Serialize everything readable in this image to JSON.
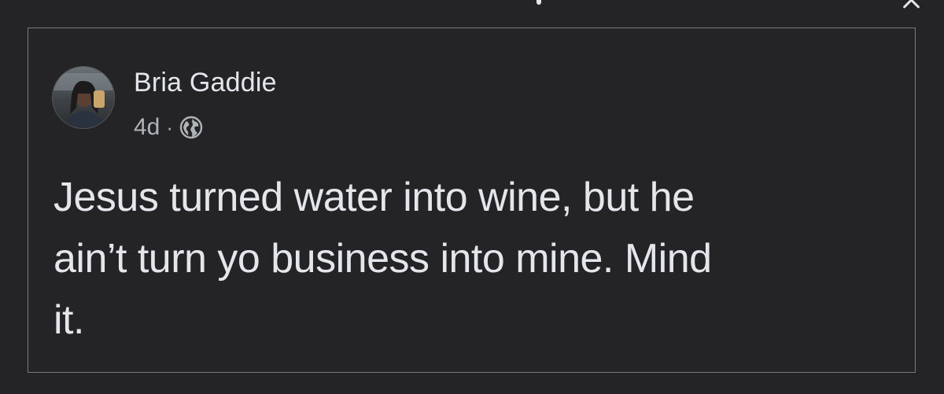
{
  "post": {
    "author_name": "Bria Gaddie",
    "timestamp": "4d",
    "separator": "·",
    "audience_icon": "globe-icon",
    "text": "Jesus turned water into wine, but he\nain’t turn yo business into mine. Mind\nit."
  },
  "colors": {
    "background": "#242426",
    "primary_text": "#e4e6eb",
    "secondary_text": "#b0b3b8",
    "border": "#7a7a7c"
  },
  "icons": {
    "close": "close-icon"
  }
}
